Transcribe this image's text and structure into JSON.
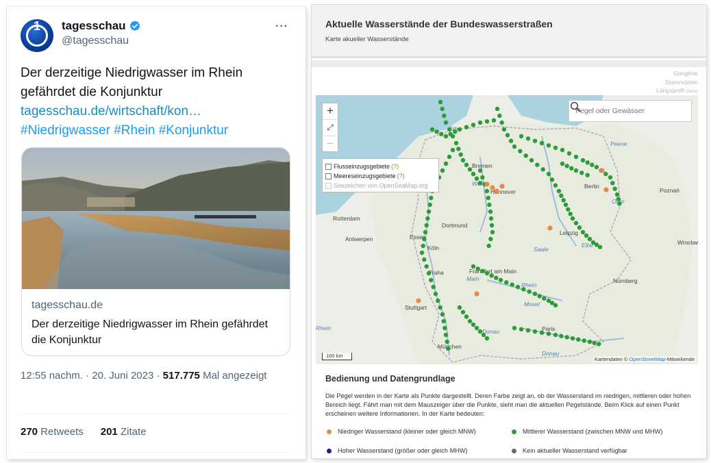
{
  "tweet": {
    "account_name": "tagesschau",
    "handle": "@tagesschau",
    "avatar_glyph": "1",
    "more_label": "···",
    "text": "Der derzeitige Niedrigwasser im Rhein gefährdet die Konjunktur",
    "link": "tagesschau.de/wirtschaft/kon…",
    "hashtags": [
      "#Niedrigwasser",
      "#Rhein",
      "#Konjunktur"
    ],
    "card": {
      "domain": "tagesschau.de",
      "title": "Der derzeitige Niedrigwasser im Rhein gefährdet die Konjunktur"
    },
    "time": "12:55 nachm.",
    "date": "20. Juni 2023",
    "views_count": "517.775",
    "views_label": "Mal angezeigt",
    "retweets_count": "270",
    "retweets_label": "Retweets",
    "quotes_count": "201",
    "quotes_label": "Zitate",
    "colors": {
      "link": "#1d9bf0",
      "text": "#0f1419",
      "muted": "#536471"
    }
  },
  "wsv": {
    "title": "Aktuelle Wasserstände der Bundeswasserstraßen",
    "subtitle": "Karte akueller Wasserstände",
    "links": [
      "Ganglinie",
      "Stammdaten",
      "Längsprofil"
    ],
    "links_beta": "(beta)",
    "search_placeholder": "Pegel oder Gewässer",
    "zoom_in": "+",
    "zoom_extent": "⤢",
    "zoom_out": "−",
    "layers": [
      {
        "label": "Flusseinzugsgebiete",
        "hint": "(?)"
      },
      {
        "label": "Meereseinzugsgebiete",
        "hint": "(?)"
      },
      {
        "label": "Seezeichen von OpenSeaMap.org",
        "hint": ""
      }
    ],
    "scale_label": "100 km",
    "attribution_prefix": "Kartendaten ©",
    "attribution_link": "OpenStreetMap",
    "attribution_suffix": "-Mitwirkende",
    "map_labels": [
      "Elbe",
      "Bremen",
      "Weser",
      "Hannover",
      "Berlin",
      "Oder",
      "Poznań",
      "Rotterdam",
      "Antwerpen",
      "Dortmund",
      "Essen",
      "Köln",
      "Leipzig",
      "Elbe",
      "Saale",
      "Wrocław",
      "Frankfurt am Main",
      "Main",
      "Rhein",
      "Praha",
      "Nürnberg",
      "Mosel",
      "Stuttgart",
      "Donau",
      "Paris",
      "Rhein",
      "München",
      "Donau",
      "Peene"
    ],
    "section_title": "Bedienung und Datengrundlage",
    "section_text": "Die Pegel werden in der Karte als Punkte dargestellt. Deren Farbe zeigt an, ob der Wasserstand im niedrigen, mittleren oder hohen Bereich liegt. Fährt man mit dem Mauszeiger über die Punkte, sieht man die aktuellen Pegelstände. Beim Klick auf einen Punkt erscheinen weitere Informationen. In der Karte bedeuten:",
    "legend": [
      {
        "label": "Niedriger Wasserstand (kleiner oder gleich MNW)",
        "color": "#e8894a"
      },
      {
        "label": "Mittlerer Wasserstand (zwischen MNW und MHW)",
        "color": "#2f9a3a"
      },
      {
        "label": "Hoher Wasserstand (größer oder gleich MHW)",
        "color": "#1c1c8f"
      },
      {
        "label": "Kein aktueller Wasserstand verfügbar",
        "color": "#6b6b6b"
      }
    ]
  }
}
